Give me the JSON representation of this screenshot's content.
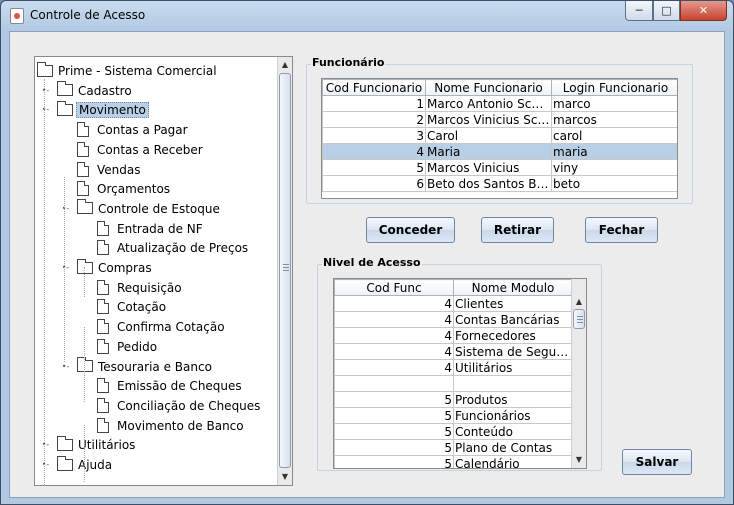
{
  "window": {
    "title": "Controle de Acesso"
  },
  "tree": {
    "root": "Prime - Sistema Comercial",
    "rows": [
      {
        "label": "Cadastro",
        "type": "folder",
        "level": 1
      },
      {
        "label": "Movimento",
        "type": "folder",
        "level": 1,
        "selected": true
      },
      {
        "label": "Contas a Pagar",
        "type": "doc",
        "level": 2
      },
      {
        "label": "Contas a Receber",
        "type": "doc",
        "level": 2
      },
      {
        "label": "Vendas",
        "type": "doc",
        "level": 2
      },
      {
        "label": "Orçamentos",
        "type": "doc",
        "level": 2
      },
      {
        "label": "Controle de Estoque",
        "type": "folder",
        "level": 2
      },
      {
        "label": "Entrada de NF",
        "type": "doc",
        "level": 3
      },
      {
        "label": "Atualização de Preços",
        "type": "doc",
        "level": 3
      },
      {
        "label": "Compras",
        "type": "folder",
        "level": 2
      },
      {
        "label": "Requisição",
        "type": "doc",
        "level": 3
      },
      {
        "label": "Cotação",
        "type": "doc",
        "level": 3
      },
      {
        "label": "Confirma Cotação",
        "type": "doc",
        "level": 3
      },
      {
        "label": "Pedido",
        "type": "doc",
        "level": 3
      },
      {
        "label": "Tesouraria e Banco",
        "type": "folder",
        "level": 2
      },
      {
        "label": "Emissão de Cheques",
        "type": "doc",
        "level": 3
      },
      {
        "label": "Conciliação de Cheques",
        "type": "doc",
        "level": 3
      },
      {
        "label": "Movimento de Banco",
        "type": "doc",
        "level": 3
      },
      {
        "label": "Utilitários",
        "type": "folder",
        "level": 1
      },
      {
        "label": "Ajuda",
        "type": "folder",
        "level": 1
      }
    ]
  },
  "funcionario": {
    "title": "Funcionário",
    "columns": [
      "Cod Funcionario",
      "Nome Funcionario",
      "Login Funcionario"
    ],
    "rows": [
      [
        "1",
        "Marco Antonio Scholl",
        "marco"
      ],
      [
        "2",
        "Marcos Vinicius Scholl",
        "marcos"
      ],
      [
        "3",
        "Carol",
        "carol"
      ],
      [
        "4",
        "Maria",
        "maria"
      ],
      [
        "5",
        "Marcos Vinicius",
        "viny"
      ],
      [
        "6",
        "Beto dos Santos Brito",
        "beto"
      ]
    ],
    "selected_row": 3
  },
  "buttons": {
    "conceder": "Conceder",
    "retirar": "Retirar",
    "fechar": "Fechar",
    "salvar": "Salvar"
  },
  "nivel": {
    "title": "Nivel de Acesso",
    "columns": [
      "Cod Func",
      "Nome Modulo"
    ],
    "rows": [
      [
        "4",
        "Clientes"
      ],
      [
        "4",
        "Contas Bancárias"
      ],
      [
        "4",
        "Fornecedores"
      ],
      [
        "4",
        "Sistema de Segura..."
      ],
      [
        "4",
        "Utilitários"
      ],
      [
        "",
        ""
      ],
      [
        "5",
        "Produtos"
      ],
      [
        "5",
        "Funcionários"
      ],
      [
        "5",
        "Conteúdo"
      ],
      [
        "5",
        "Plano de Contas"
      ],
      [
        "5",
        "Calendário"
      ]
    ]
  }
}
